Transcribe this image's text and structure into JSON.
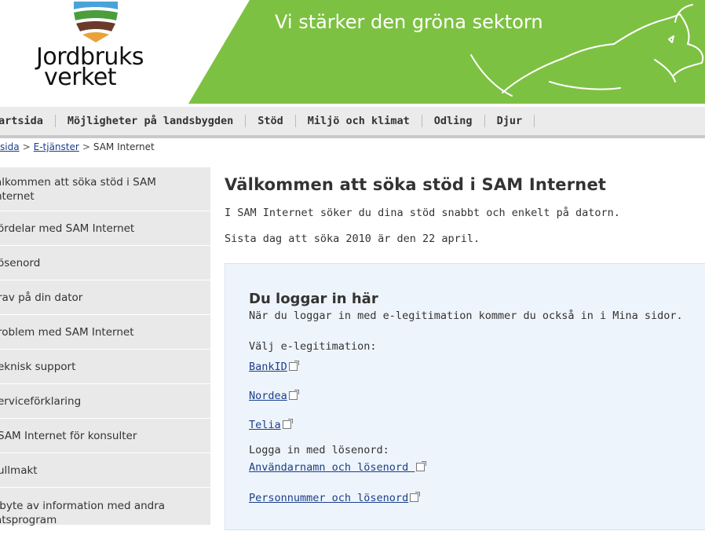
{
  "header": {
    "logo_line1": "Jordbruks",
    "logo_line2": "verket",
    "tagline": "Vi stärker den gröna sektorn"
  },
  "nav": {
    "items": [
      "artsida",
      "Möjligheter på landsbygden",
      "Stöd",
      "Miljö och klimat",
      "Odling",
      "Djur"
    ]
  },
  "breadcrumb": {
    "home": "sida",
    "etjanster": "E-tjänster",
    "current": "SAM Internet",
    "separator": ">"
  },
  "sidebar": {
    "items": [
      {
        "l1": "älkommen att söka stöd i SAM",
        "l2": "nternet"
      },
      {
        "l1": "ördelar med SAM Internet"
      },
      {
        "l1": "ösenord"
      },
      {
        "l1": "rav på din dator"
      },
      {
        "l1": "roblem med SAM Internet"
      },
      {
        "l1": "eknisk support"
      },
      {
        "l1": "erviceförklaring"
      },
      {
        "l1": "SAM Internet för konsulter"
      },
      {
        "l1": "ullmakt"
      },
      {
        "l1": "tbyte av information med andra",
        "l2": "atsprogram"
      }
    ]
  },
  "main": {
    "title": "Välkommen att söka stöd i SAM Internet",
    "intro1": "I SAM Internet söker du dina stöd snabbt och enkelt på datorn.",
    "intro2": "Sista dag att söka 2010 är den 22 april."
  },
  "login": {
    "title": "Du loggar in här",
    "description": "När du loggar in med e-legitimation kommer du också in i Mina sidor.",
    "elegit_label": "Välj e-legitimation:",
    "bankid": "BankID",
    "nordea": "Nordea",
    "telia": "Telia",
    "password_label": "Logga in med lösenord:",
    "user_pass": "Användarnamn och lösenord ",
    "pnr_pass": "Personnummer och lösenord"
  },
  "colors": {
    "banner_green": "#7dc142",
    "nav_bg": "#ebebeb",
    "sidebar_bg": "#e9e9e9",
    "login_bg": "#eef4fb",
    "link": "#1a3f8b"
  }
}
